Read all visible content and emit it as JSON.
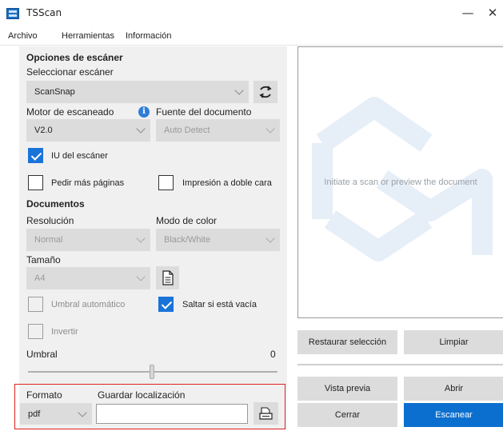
{
  "window": {
    "title": "TSScan",
    "minimize": "—",
    "close": "✕"
  },
  "menu": [
    "Archivo",
    "Herramientas",
    "Información"
  ],
  "scanner_options": {
    "heading": "Opciones de escáner",
    "select_label": "Seleccionar escáner",
    "scanner_value": "ScanSnap",
    "engine_label": "Motor de escaneado",
    "engine_value": "V2.0",
    "source_label": "Fuente del documento",
    "source_value": "Auto Detect",
    "scanner_ui_label": "IU del escáner",
    "scanner_ui_checked": true,
    "more_pages_label": "Pedir más páginas",
    "more_pages_checked": false,
    "duplex_label": "Impresión a doble cara",
    "duplex_checked": false
  },
  "documents": {
    "heading": "Documentos",
    "resolution_label": "Resolución",
    "resolution_value": "Normal",
    "color_mode_label": "Modo de color",
    "color_mode_value": "Black/White",
    "size_label": "Tamaño",
    "size_value": "A4",
    "auto_threshold_label": "Umbral automático",
    "auto_threshold_checked": false,
    "skip_blank_label": "Saltar si está vacía",
    "skip_blank_checked": true,
    "invert_label": "Invertir",
    "invert_checked": false,
    "threshold_label": "Umbral",
    "threshold_value": "0"
  },
  "output": {
    "format_label": "Formato",
    "format_value": "pdf",
    "save_location_label": "Guardar localización",
    "save_location_value": ""
  },
  "preview": {
    "placeholder": "Initiate a scan or preview the document"
  },
  "buttons": {
    "restore_selection": "Restaurar selección",
    "clear": "Limpiar",
    "preview": "Vista previa",
    "open": "Abrir",
    "close": "Cerrar",
    "scan": "Escanear"
  },
  "colors": {
    "accent": "#0b6fcf",
    "panel": "#f0f0f0",
    "highlight": "#e02020"
  }
}
